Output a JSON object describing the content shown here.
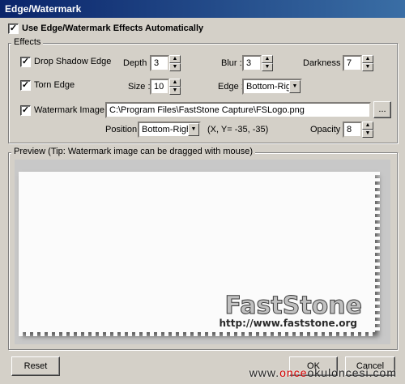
{
  "window": {
    "title": "Edge/Watermark"
  },
  "use_auto": {
    "label": "Use Edge/Watermark Effects Automatically",
    "checked": true
  },
  "effects": {
    "legend": "Effects",
    "drop_shadow": {
      "label": "Drop Shadow Edge",
      "checked": true,
      "depth_label": "Depth :",
      "depth": "3",
      "blur_label": "Blur :",
      "blur": "3",
      "darkness_label": "Darkness :",
      "darkness": "7"
    },
    "torn": {
      "label": "Torn Edge",
      "checked": true,
      "size_label": "Size :",
      "size": "10",
      "edge_label": "Edge :",
      "edge": "Bottom-Right"
    },
    "watermark": {
      "label": "Watermark Image",
      "checked": true,
      "path": "C:\\Program Files\\FastStone Capture\\FSLogo.png",
      "browse_label": "...",
      "position_label": "Position :",
      "position": "Bottom-Right",
      "coords": "(X, Y= -35, -35)",
      "opacity_label": "Opacity :",
      "opacity": "8"
    }
  },
  "preview": {
    "legend": "Preview (Tip: Watermark image can be dragged with mouse)",
    "logo_text": "FastStone",
    "logo_url": "http://www.faststone.org"
  },
  "buttons": {
    "reset": "Reset",
    "ok": "OK",
    "cancel": "Cancel"
  },
  "site_watermark": {
    "prefix": "www.",
    "highlight": "once",
    "suffix": "okuloncesi.com"
  },
  "colors": {
    "titlebar_start": "#0a246a",
    "titlebar_end": "#3a6ea5",
    "face": "#d4d0c8",
    "site_highlight": "#d40000"
  },
  "icons": {
    "check": "check-mark",
    "spin_up": "up-arrow",
    "spin_down": "down-arrow",
    "combo": "down-arrow"
  }
}
